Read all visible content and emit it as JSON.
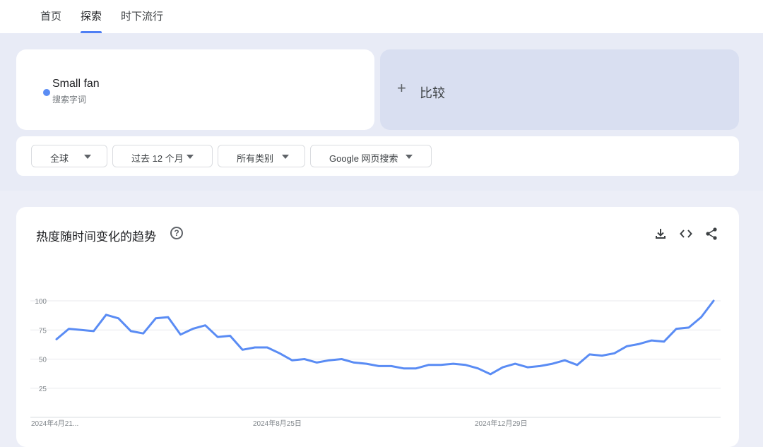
{
  "nav": {
    "tabs": [
      {
        "label": "首页"
      },
      {
        "label": "探索"
      },
      {
        "label": "时下流行"
      }
    ],
    "active_index": 1
  },
  "search_term": {
    "name": "Small fan",
    "subtitle": "搜索字词",
    "color": "#5a8cf4"
  },
  "compare": {
    "icon": "plus-icon",
    "label": "比较"
  },
  "filters": [
    {
      "label": "全球"
    },
    {
      "label": "过去 12 个月"
    },
    {
      "label": "所有类别"
    },
    {
      "label": "Google 网页搜索"
    }
  ],
  "chart_card": {
    "title": "热度随时间变化的趋势",
    "icons": [
      "help-icon",
      "download-icon",
      "embed-code-icon",
      "share-icon"
    ]
  },
  "chart_data": {
    "type": "line",
    "title": "",
    "xlabel": "",
    "ylabel": "",
    "ylim": [
      0,
      100
    ],
    "yticks": [
      25,
      50,
      75,
      100
    ],
    "x_tick_labels": [
      "2024年4月21...",
      "2024年8月25日",
      "2024年12月29日"
    ],
    "x_tick_indices": [
      0,
      18,
      36
    ],
    "grid": true,
    "series": [
      {
        "color": "#5a8cf4",
        "values": [
          67,
          76,
          75,
          74,
          88,
          85,
          74,
          72,
          85,
          86,
          71,
          76,
          79,
          69,
          70,
          58,
          60,
          60,
          55,
          49,
          50,
          47,
          49,
          50,
          47,
          46,
          44,
          44,
          42,
          42,
          45,
          45,
          46,
          45,
          42,
          37,
          43,
          46,
          43,
          44,
          46,
          49,
          45,
          54,
          53,
          55,
          61,
          63,
          66,
          65,
          76,
          77,
          86,
          100
        ]
      }
    ]
  }
}
